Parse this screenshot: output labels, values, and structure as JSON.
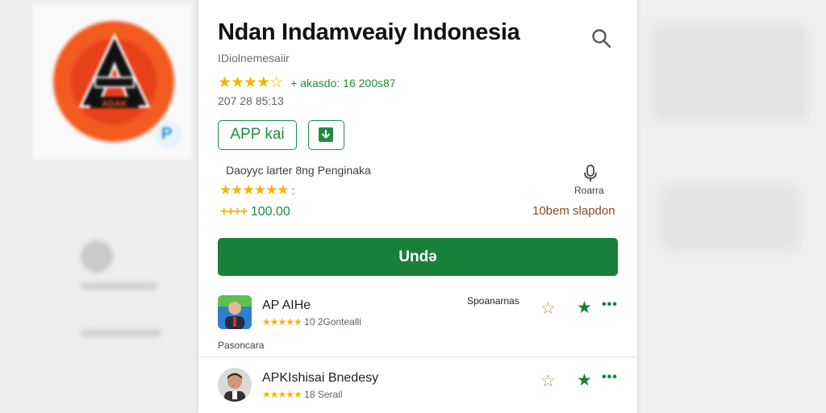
{
  "app": {
    "title": "Ndan Indamveaiy Indonesia",
    "subtitle": "IDiolnemesaiir",
    "rating_stars": "★★★★☆",
    "meta_text": "+ akasdo: 16 200s87",
    "date_line": "207 28 85:13"
  },
  "actions": {
    "app_kai_label": "APP kai",
    "install_label": "Undǝ"
  },
  "stats": {
    "developer_line": "Daoyyc larter 8ng Penginaka",
    "stars": "★★★★★★",
    "stars_colon": ":",
    "review_plus": "++++",
    "review_count": "100.00",
    "mic_label": "Roarra",
    "installs": "10bem slapdon"
  },
  "list": {
    "items": [
      {
        "name": "AP AIHe",
        "stars": "★★★★★",
        "meta": "10 2Gontealli",
        "tag": "Spoanarnas"
      },
      {
        "name": "APKIshisai Bnedesy",
        "stars": "★★★★★",
        "meta": "18 Serail",
        "tag": ""
      }
    ],
    "section_label": "Pasoncara",
    "more_glyph": "•••",
    "star_outline_glyph": "☆",
    "star_filled_glyph": "★"
  },
  "background": {
    "logo_text": "ADAK"
  },
  "colors": {
    "accent_green": "#188038",
    "star_yellow": "#f4b400",
    "logo_orange": "#f25a1f"
  },
  "icons": {
    "search": "search-icon",
    "download": "download-icon",
    "mic": "mic-icon"
  }
}
